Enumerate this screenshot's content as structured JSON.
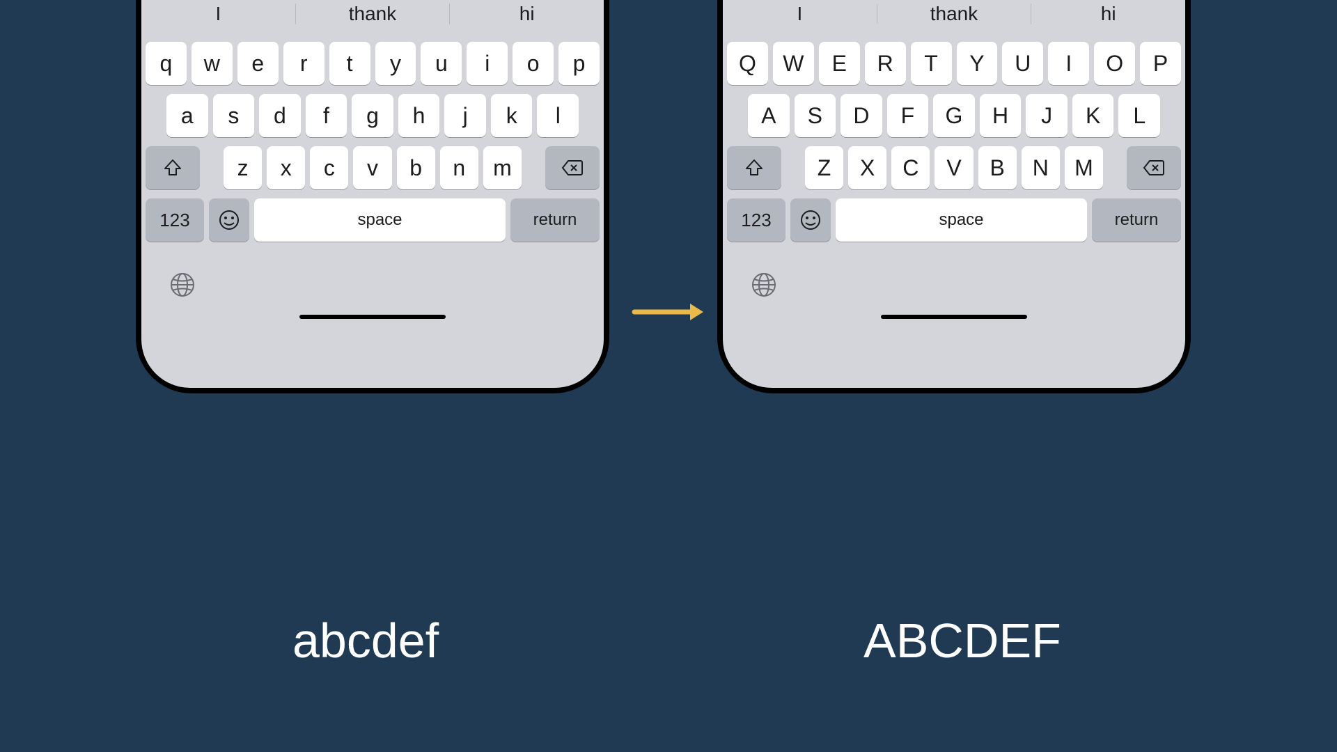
{
  "left": {
    "caption": "abcdef",
    "predictions": [
      "I",
      "thank",
      "hi"
    ],
    "rows": [
      [
        "q",
        "w",
        "e",
        "r",
        "t",
        "y",
        "u",
        "i",
        "o",
        "p"
      ],
      [
        "a",
        "s",
        "d",
        "f",
        "g",
        "h",
        "j",
        "k",
        "l"
      ],
      [
        "z",
        "x",
        "c",
        "v",
        "b",
        "n",
        "m"
      ]
    ],
    "k123": "123",
    "space": "space",
    "return": "return"
  },
  "right": {
    "caption": "ABCDEF",
    "predictions": [
      "I",
      "thank",
      "hi"
    ],
    "rows": [
      [
        "Q",
        "W",
        "E",
        "R",
        "T",
        "Y",
        "U",
        "I",
        "O",
        "P"
      ],
      [
        "A",
        "S",
        "D",
        "F",
        "G",
        "H",
        "J",
        "K",
        "L"
      ],
      [
        "Z",
        "X",
        "C",
        "V",
        "B",
        "N",
        "M"
      ]
    ],
    "k123": "123",
    "space": "space",
    "return": "return"
  }
}
